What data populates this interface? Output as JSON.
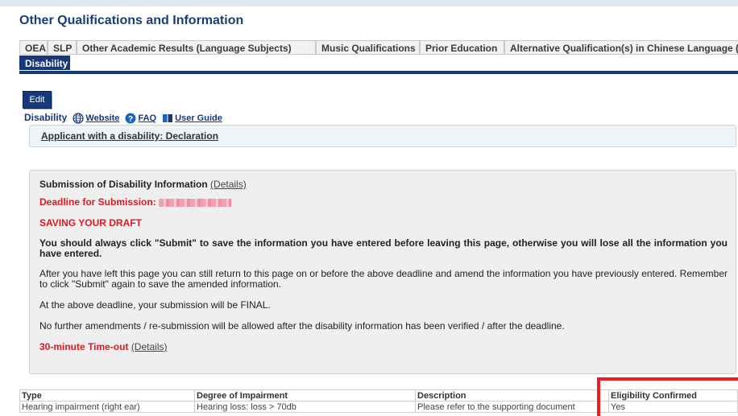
{
  "page": {
    "title": "Other Qualifications and Information"
  },
  "tabs": [
    {
      "label": "OEA"
    },
    {
      "label": "SLP"
    },
    {
      "label": "Other Academic Results (Language Subjects)"
    },
    {
      "label": "Music Qualifications"
    },
    {
      "label": "Prior Education"
    },
    {
      "label": "Alternative Qualification(s) in Chinese Language (ACL)"
    },
    {
      "label": "Disability",
      "active": true
    }
  ],
  "toolbar": {
    "edit_label": "Edit"
  },
  "subnav": {
    "section_label": "Disability",
    "website_label": "Website",
    "faq_label": "FAQ",
    "guide_label": "User Guide"
  },
  "declaration": {
    "link_label": "Applicant with a disability: Declaration"
  },
  "info": {
    "heading": "Submission of Disability Information",
    "details_label": "(Details)",
    "deadline_label": "Deadline for Submission:",
    "saving_heading": "SAVING YOUR DRAFT",
    "warning": "You should always click \"Submit\" to save the information you have entered before leaving this page, otherwise you will lose all the information you have entered.",
    "return_note": "After you have left this page you can still return to this page on or before the above deadline and amend the information you have previously entered. Remember to click \"Submit\" again to save the amended information.",
    "final_note": "At the above deadline, your submission will be FINAL.",
    "no_amend_note": "No further amendments / re-submission will be allowed after the disability information has been verified / after the deadline.",
    "timeout_label": "30-minute Time-out",
    "timeout_details_label": "(Details)"
  },
  "impairment_table": {
    "headers": [
      "Type",
      "Degree of Impairment",
      "Description",
      "Eligibility Confirmed"
    ],
    "rows": [
      [
        "Hearing impairment (right ear)",
        "Hearing loss: loss > 70db",
        "Please refer to the supporting document",
        "Yes"
      ]
    ]
  },
  "colors": {
    "brand": "#17397a",
    "alert": "#e0181f",
    "highlight": "#ec1b24"
  },
  "icons": [
    "globe-icon",
    "help-icon",
    "book-icon"
  ]
}
